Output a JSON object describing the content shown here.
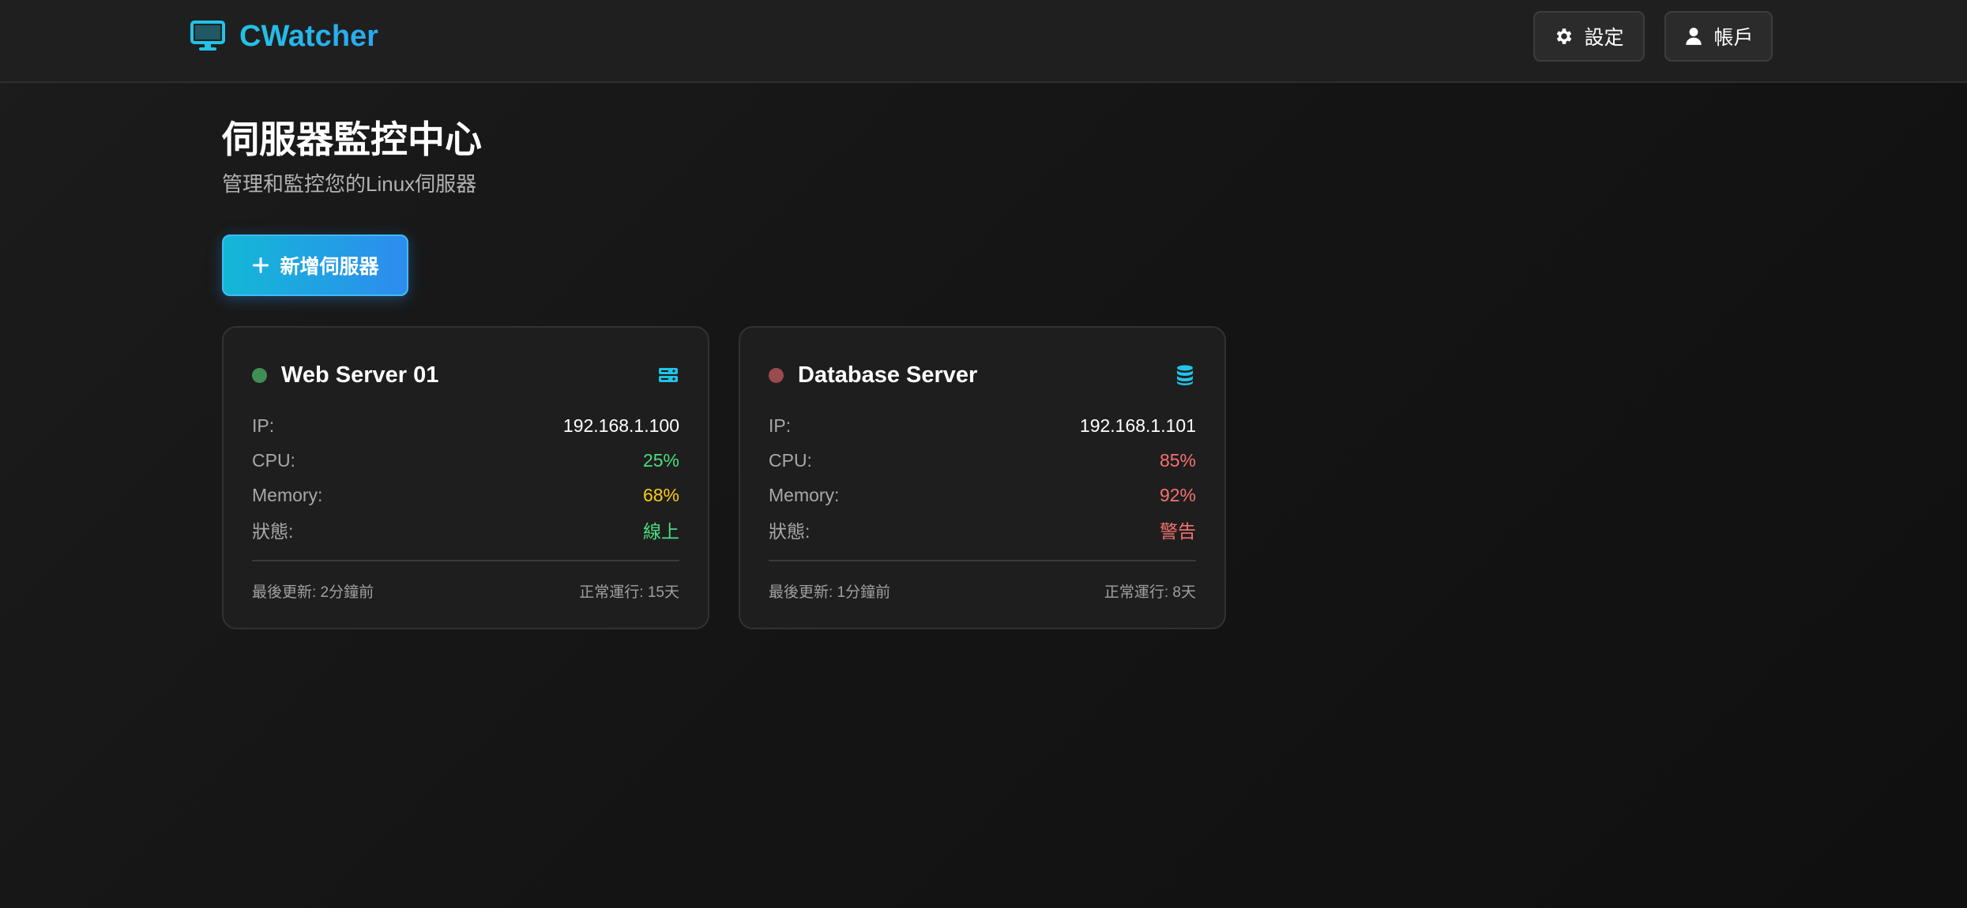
{
  "app": {
    "name": "CWatcher",
    "logo_icon": "monitor-icon",
    "accent": "#22c3e6"
  },
  "header": {
    "settings": {
      "label": "設定",
      "icon": "gear-icon"
    },
    "account": {
      "label": "帳戶",
      "icon": "user-icon"
    }
  },
  "main": {
    "title": "伺服器監控中心",
    "subtitle": "管理和監控您的Linux伺服器",
    "add_button": {
      "label": "新增伺服器",
      "icon": "plus-icon"
    }
  },
  "colors": {
    "good": "#4ade80",
    "warn": "#facc15",
    "danger": "#f87171",
    "dot_online": "#3f8f55",
    "dot_warning": "#9a4b4e"
  },
  "servers": [
    {
      "name": "Web Server 01",
      "icon": "server-icon",
      "status_dot": "online",
      "ip_label": "IP:",
      "ip": "192.168.1.100",
      "cpu_label": "CPU:",
      "cpu": "25%",
      "memory_label": "Memory:",
      "memory": "68%",
      "status_label": "狀態:",
      "status": "線上",
      "last_update": "最後更新: 2分鐘前",
      "uptime": "正常運行: 15天"
    },
    {
      "name": "Database Server",
      "icon": "database-icon",
      "status_dot": "warning",
      "ip_label": "IP:",
      "ip": "192.168.1.101",
      "cpu_label": "CPU:",
      "cpu": "85%",
      "memory_label": "Memory:",
      "memory": "92%",
      "status_label": "狀態:",
      "status": "警告",
      "last_update": "最後更新: 1分鐘前",
      "uptime": "正常運行: 8天"
    }
  ]
}
